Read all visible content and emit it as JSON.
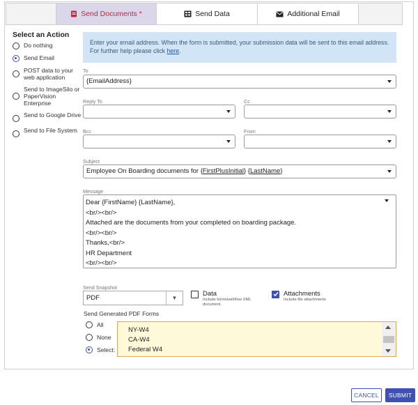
{
  "tabs": {
    "send_documents": "Send Documents *",
    "send_data": "Send Data",
    "additional_email": "Additional Email"
  },
  "sidebar": {
    "title": "Select an Action",
    "options": [
      {
        "label": "Do nothing",
        "selected": false
      },
      {
        "label": "Send Email",
        "selected": true
      },
      {
        "label": "POST data to your web application",
        "selected": false
      },
      {
        "label": "Send to ImageSilo or PaperVision Enterprise",
        "selected": false
      },
      {
        "label": "Send to Google Drive",
        "selected": false
      },
      {
        "label": "Send to File System",
        "selected": false
      }
    ]
  },
  "info": {
    "text": "Enter your email address. When the form is submitted, your submission data will be sent to this email address. For further help please click",
    "link": "here",
    "end": "."
  },
  "fields": {
    "to_label": "To",
    "to_value": "{EmailAddress}",
    "reply_to_label": "Reply To",
    "reply_to_value": "",
    "cc_label": "Cc",
    "cc_value": "",
    "bcc_label": "Bcc",
    "bcc_value": "",
    "from_label": "From",
    "from_value": "",
    "subject_label": "Subject",
    "subject_prefix": "Employee On Boarding documents for {",
    "subject_token1": "FirstPlusInitial",
    "subject_mid": "} {",
    "subject_token2": "LastName",
    "subject_end": "}",
    "message_label": "Message",
    "message_lines": [
      "Dear {FirstName} {LastName},",
      "<br/><br/>",
      "Attached are the documents from your completed on boarding package.",
      "<br/><br/>",
      "Thanks,<br/>",
      "HR Department",
      "<br/><br/>"
    ]
  },
  "snapshot": {
    "label": "Send Snapshot",
    "value": "PDF",
    "data_label": "Data",
    "data_sub": "Include form/workflow XML document",
    "data_checked": false,
    "attachments_label": "Attachments",
    "attachments_sub": "Include file attachments",
    "attachments_checked": true
  },
  "pdf_forms": {
    "title": "Send Generated PDF Forms",
    "options": [
      {
        "label": "All",
        "selected": false
      },
      {
        "label": "None",
        "selected": false
      },
      {
        "label": "Select:",
        "selected": true
      }
    ],
    "items": [
      "NY-W4",
      "CA-W4",
      "Federal W4"
    ]
  },
  "buttons": {
    "cancel": "CANCEL",
    "submit": "SUBMIT"
  },
  "colors": {
    "accent": "#3f51b5",
    "active_tab_bg": "#dcd6ea",
    "active_tab_text": "#c0263d",
    "info_bg": "#d1e5f6",
    "list_bg": "#fef9d8",
    "list_border": "#e0a55b"
  }
}
